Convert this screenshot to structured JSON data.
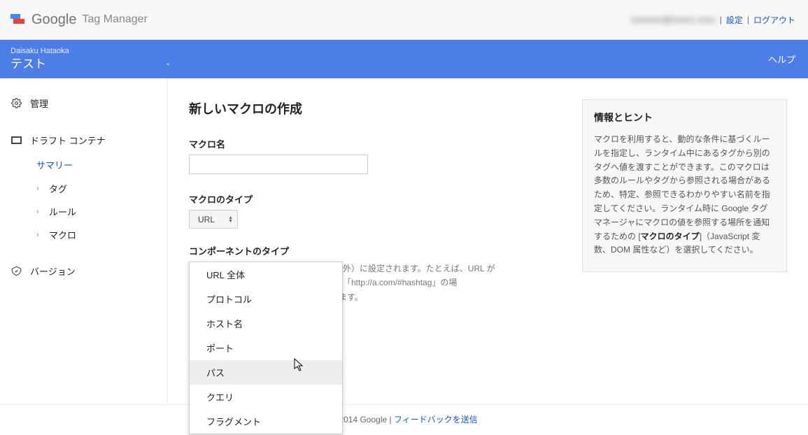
{
  "header": {
    "google": "Google",
    "product": "Tag Manager",
    "email_blurred": "xxxxxxx@xxxxx.xxxx",
    "settings": "設定",
    "logout": "ログアウト"
  },
  "bluebar": {
    "account": "Daisaku Hataoka",
    "container": "テスト",
    "help": "ヘルプ"
  },
  "sidebar": {
    "manage": "管理",
    "draft": "ドラフト コンテナ",
    "summary": "サマリー",
    "tags": "タグ",
    "rules": "ルール",
    "macros": "マクロ",
    "version": "バージョン"
  },
  "form": {
    "title": "新しいマクロの作成",
    "name_label": "マクロ名",
    "name_value": "",
    "type_label": "マクロのタイプ",
    "type_value": "URL",
    "component_label": "コンポーネントのタイプ",
    "behind_1": "外）に設定されます。たとえば、URL が「http://a.com/#hashtag」の場",
    "behind_2": "なります。"
  },
  "dropdown": {
    "items": [
      "URL 全体",
      "プロトコル",
      "ホスト名",
      "ポート",
      "パス",
      "クエリ",
      "フラグメント"
    ],
    "hover_index": 4
  },
  "info": {
    "title": "情報とヒント",
    "body_1": "マクロを利用すると、動的な条件に基づくルールを指定し、ランタイム中にあるタグから別のタグへ値を渡すことができます。このマクロは多数のルールやタグから参照される場合があるため、特定、参照できるわかりやすい名前を指定してください。ランタイム時に Google タグマネージャにマクロの値を参照する場所を通知するための [",
    "body_bold": "マクロのタイプ",
    "body_2": "]（JavaScript 変数、DOM 属性など）を選択してください。"
  },
  "footer": {
    "copyright": "© 2014 Google",
    "feedback": "フィードバックを送信"
  }
}
